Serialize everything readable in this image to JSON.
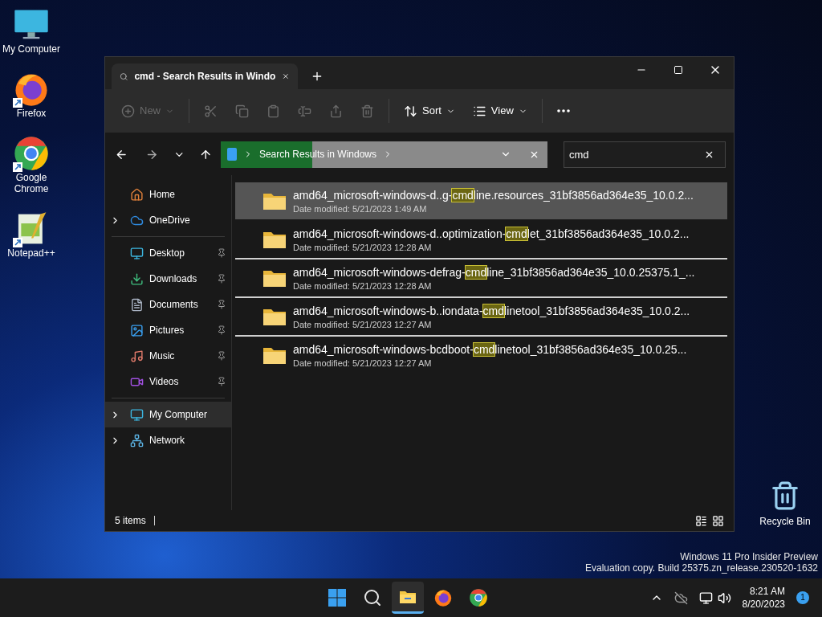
{
  "desktop_icons": [
    {
      "label": "My Computer",
      "kind": "computer",
      "shortcut": false
    },
    {
      "label": "Firefox",
      "kind": "firefox",
      "shortcut": true
    },
    {
      "label": "Google Chrome",
      "kind": "chrome",
      "shortcut": true
    },
    {
      "label": "Notepad++",
      "kind": "notepad",
      "shortcut": true
    }
  ],
  "recycle_bin": {
    "label": "Recycle Bin"
  },
  "window": {
    "tab": {
      "title": "cmd - Search Results in Windo"
    },
    "toolbar": [
      {
        "kind": "new",
        "label": "New",
        "disabled": true
      },
      {
        "kind": "cut",
        "disabled": true
      },
      {
        "kind": "copy",
        "disabled": true
      },
      {
        "kind": "paste",
        "disabled": true
      },
      {
        "kind": "rename",
        "disabled": true
      },
      {
        "kind": "share",
        "disabled": true
      },
      {
        "kind": "delete",
        "disabled": true
      },
      {
        "kind": "sort",
        "label": "Sort",
        "disabled": false
      },
      {
        "kind": "view",
        "label": "View",
        "disabled": false
      },
      {
        "kind": "more",
        "disabled": false
      }
    ],
    "address": {
      "location": "Search Results in Windows",
      "level": 0.28
    },
    "search": {
      "value": "cmd"
    },
    "sidebar": [
      [
        {
          "label": "Home",
          "kind": "home",
          "expandable": false,
          "pinned": false,
          "selected": false
        },
        {
          "label": "OneDrive",
          "kind": "cloud",
          "expandable": true,
          "pinned": false,
          "selected": false
        }
      ],
      [
        {
          "label": "Desktop",
          "kind": "desktop",
          "expandable": false,
          "pinned": true,
          "selected": false
        },
        {
          "label": "Downloads",
          "kind": "downloads",
          "expandable": false,
          "pinned": true,
          "selected": false
        },
        {
          "label": "Documents",
          "kind": "documents",
          "expandable": false,
          "pinned": true,
          "selected": false
        },
        {
          "label": "Pictures",
          "kind": "pictures",
          "expandable": false,
          "pinned": true,
          "selected": false
        },
        {
          "label": "Music",
          "kind": "music",
          "expandable": false,
          "pinned": true,
          "selected": false
        },
        {
          "label": "Videos",
          "kind": "videos",
          "expandable": false,
          "pinned": true,
          "selected": false
        }
      ],
      [
        {
          "label": "My Computer",
          "kind": "computer",
          "expandable": true,
          "pinned": false,
          "selected": true
        },
        {
          "label": "Network",
          "kind": "network",
          "expandable": true,
          "pinned": false,
          "selected": false
        }
      ]
    ],
    "results": [
      {
        "before": "amd64_microsoft-windows-d..g-",
        "match": "cmd",
        "after": "line.resources_31bf3856ad364e35_10.0.2...",
        "modified": "Date modified: 5/21/2023 1:49 AM",
        "selected": true,
        "divider_below": false
      },
      {
        "before": "amd64_microsoft-windows-d..optimization-",
        "match": "cmd",
        "after": "let_31bf3856ad364e35_10.0.2...",
        "modified": "Date modified: 5/21/2023 12:28 AM",
        "selected": false,
        "divider_below": true
      },
      {
        "before": "amd64_microsoft-windows-defrag-",
        "match": "cmd",
        "after": "line_31bf3856ad364e35_10.0.25375.1_...",
        "modified": "Date modified: 5/21/2023 12:28 AM",
        "selected": false,
        "divider_below": true
      },
      {
        "before": "amd64_microsoft-windows-b..iondata-",
        "match": "cmd",
        "after": "linetool_31bf3856ad364e35_10.0.2...",
        "modified": "Date modified: 5/21/2023 12:27 AM",
        "selected": false,
        "divider_below": true
      },
      {
        "before": "amd64_microsoft-windows-bcdboot-",
        "match": "cmd",
        "after": "linetool_31bf3856ad364e35_10.0.25...",
        "modified": "Date modified: 5/21/2023 12:27 AM",
        "selected": false,
        "divider_below": false
      }
    ],
    "status": "5 items"
  },
  "os_notice": [
    "Windows 11 Pro Insider Preview",
    "Evaluation copy. Build 25375.zn_release.230520-1632"
  ],
  "taskbar": {
    "apps": [
      {
        "kind": "start",
        "active": false
      },
      {
        "kind": "search",
        "active": false
      },
      {
        "kind": "explorer",
        "active": true
      },
      {
        "kind": "firefox",
        "active": false
      },
      {
        "kind": "chrome",
        "active": false
      }
    ],
    "time": "8:21 AM",
    "date": "8/20/2023",
    "notifications": "1"
  }
}
